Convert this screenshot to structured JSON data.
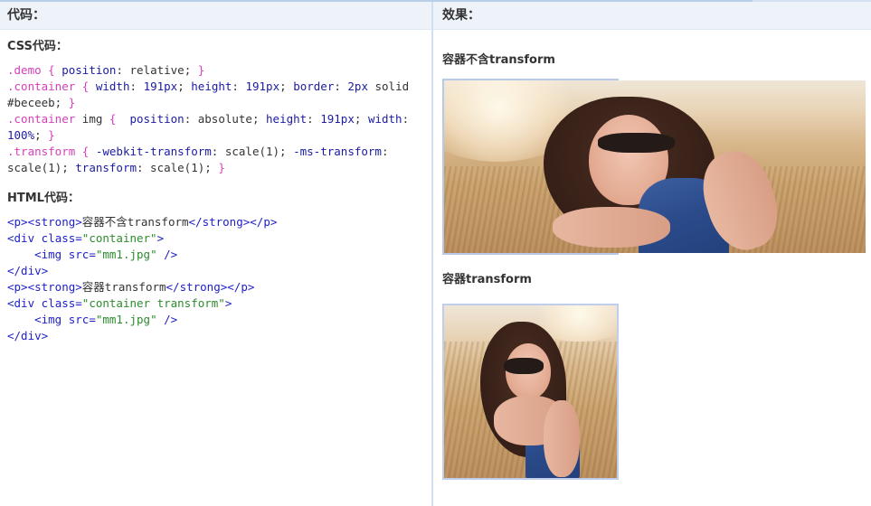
{
  "left_panel": {
    "header": "代码：",
    "css_title": "CSS代码：",
    "css_lines": [
      [
        {
          "c": "sel",
          "t": ".demo "
        },
        {
          "c": "brace",
          "t": "{ "
        },
        {
          "c": "prop",
          "t": "position"
        },
        {
          "c": "plain",
          "t": ": relative; "
        },
        {
          "c": "brace",
          "t": "}"
        }
      ],
      [
        {
          "c": "sel",
          "t": ".container "
        },
        {
          "c": "brace",
          "t": "{ "
        },
        {
          "c": "prop",
          "t": "width"
        },
        {
          "c": "plain",
          "t": ": "
        },
        {
          "c": "val",
          "t": "191px"
        },
        {
          "c": "plain",
          "t": "; "
        },
        {
          "c": "prop",
          "t": "height"
        },
        {
          "c": "plain",
          "t": ": "
        },
        {
          "c": "val",
          "t": "191px"
        },
        {
          "c": "plain",
          "t": "; "
        },
        {
          "c": "prop",
          "t": "border"
        },
        {
          "c": "plain",
          "t": ": "
        },
        {
          "c": "val",
          "t": "2px"
        },
        {
          "c": "plain",
          "t": " solid"
        }
      ],
      [
        {
          "c": "plain",
          "t": "#beceeb; "
        },
        {
          "c": "brace",
          "t": "}"
        }
      ],
      [
        {
          "c": "sel",
          "t": ".container "
        },
        {
          "c": "plain",
          "t": "img "
        },
        {
          "c": "brace",
          "t": "{  "
        },
        {
          "c": "prop",
          "t": "position"
        },
        {
          "c": "plain",
          "t": ": absolute; "
        },
        {
          "c": "prop",
          "t": "height"
        },
        {
          "c": "plain",
          "t": ": "
        },
        {
          "c": "val",
          "t": "191px"
        },
        {
          "c": "plain",
          "t": "; "
        },
        {
          "c": "prop",
          "t": "width"
        },
        {
          "c": "plain",
          "t": ":"
        }
      ],
      [
        {
          "c": "val",
          "t": "100%"
        },
        {
          "c": "plain",
          "t": "; "
        },
        {
          "c": "brace",
          "t": "}"
        }
      ],
      [
        {
          "c": "sel",
          "t": ".transform "
        },
        {
          "c": "brace",
          "t": "{ "
        },
        {
          "c": "prop",
          "t": "-webkit-transform"
        },
        {
          "c": "plain",
          "t": ": scale(1); "
        },
        {
          "c": "prop",
          "t": "-ms-transform"
        },
        {
          "c": "plain",
          "t": ":"
        }
      ],
      [
        {
          "c": "plain",
          "t": "scale(1); "
        },
        {
          "c": "prop",
          "t": "transform"
        },
        {
          "c": "plain",
          "t": ": scale(1); "
        },
        {
          "c": "brace",
          "t": "}"
        }
      ]
    ],
    "html_title": "HTML代码：",
    "html_lines": [
      [
        {
          "c": "tag",
          "t": "<p><strong>"
        },
        {
          "c": "txt",
          "t": "容器不含transform"
        },
        {
          "c": "tag",
          "t": "</strong></p>"
        }
      ],
      [
        {
          "c": "tag",
          "t": "<div "
        },
        {
          "c": "attr",
          "t": "class="
        },
        {
          "c": "str",
          "t": "\"container\""
        },
        {
          "c": "tag",
          "t": ">"
        }
      ],
      [
        {
          "c": "plain",
          "t": "    "
        },
        {
          "c": "tag",
          "t": "<img "
        },
        {
          "c": "attr",
          "t": "src="
        },
        {
          "c": "str",
          "t": "\"mm1.jpg\""
        },
        {
          "c": "tag",
          "t": " />"
        }
      ],
      [
        {
          "c": "tag",
          "t": "</div>"
        }
      ],
      [
        {
          "c": "tag",
          "t": "<p><strong>"
        },
        {
          "c": "txt",
          "t": "容器transform"
        },
        {
          "c": "tag",
          "t": "</strong></p>"
        }
      ],
      [
        {
          "c": "tag",
          "t": "<div "
        },
        {
          "c": "attr",
          "t": "class="
        },
        {
          "c": "str",
          "t": "\"container transform\""
        },
        {
          "c": "tag",
          "t": ">"
        }
      ],
      [
        {
          "c": "plain",
          "t": "    "
        },
        {
          "c": "tag",
          "t": "<img "
        },
        {
          "c": "attr",
          "t": "src="
        },
        {
          "c": "str",
          "t": "\"mm1.jpg\""
        },
        {
          "c": "tag",
          "t": " />"
        }
      ],
      [
        {
          "c": "tag",
          "t": "</div>"
        }
      ]
    ]
  },
  "right_panel": {
    "header": "效果：",
    "demo1_label": "容器不含transform",
    "demo2_label": "容器transform"
  },
  "colors": {
    "header_bg": "#eef3fa",
    "divider": "#cfe0f2",
    "container_border": "#beceeb",
    "selector": "#d63fbb",
    "keyword": "#1b1ba3",
    "string": "#2e8b2e"
  }
}
